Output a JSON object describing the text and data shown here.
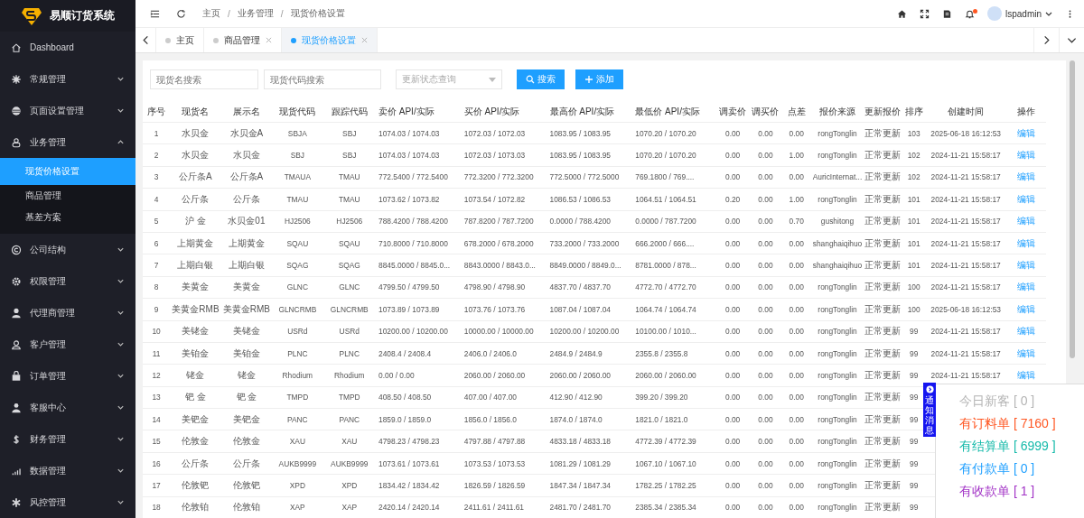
{
  "brand": {
    "title": "易顺订货系统"
  },
  "sidebar": {
    "items": [
      {
        "label": "Dashboard",
        "kind": "link"
      },
      {
        "label": "常规管理",
        "kind": "group",
        "expanded": false
      },
      {
        "label": "页面设置管理",
        "kind": "group",
        "expanded": false
      },
      {
        "label": "业务管理",
        "kind": "group",
        "expanded": true,
        "children": [
          {
            "label": "现货价格设置",
            "selected": true
          },
          {
            "label": "商品管理",
            "selected": false
          },
          {
            "label": "基差方案",
            "selected": false
          }
        ]
      },
      {
        "label": "公司结构",
        "kind": "group",
        "expanded": false
      },
      {
        "label": "权限管理",
        "kind": "group",
        "expanded": false
      },
      {
        "label": "代理商管理",
        "kind": "group",
        "expanded": false
      },
      {
        "label": "客户管理",
        "kind": "group",
        "expanded": false
      },
      {
        "label": "订单管理",
        "kind": "group",
        "expanded": false
      },
      {
        "label": "客服中心",
        "kind": "group",
        "expanded": false
      },
      {
        "label": "财务管理",
        "kind": "group",
        "expanded": false
      },
      {
        "label": "数据管理",
        "kind": "group",
        "expanded": false
      },
      {
        "label": "风控管理",
        "kind": "group",
        "expanded": false
      }
    ]
  },
  "header": {
    "breadcrumb": [
      "主页",
      "业务管理",
      "现货价格设置"
    ],
    "breadcrumb_separator": "/",
    "user": "lspadmin",
    "notification_dot": true
  },
  "tabs": [
    {
      "label": "主页",
      "selected": false,
      "closable": false
    },
    {
      "label": "商品管理",
      "selected": false,
      "closable": true
    },
    {
      "label": "现货价格设置",
      "selected": true,
      "closable": true
    }
  ],
  "filters": {
    "name_placeholder": "现货名搜索",
    "code_placeholder": "现货代码搜索",
    "status_placeholder": "更新状态查询",
    "search_button": "搜索",
    "add_button": "添加"
  },
  "table": {
    "columns": [
      "序号",
      "现货名",
      "展示名",
      "现货代码",
      "跟踪代码",
      "卖价 API/实际",
      "买价 API/实际",
      "最高价 API/实际",
      "最低价 API/实际",
      "调卖价",
      "调买价",
      "点差",
      "报价来源",
      "更新报价",
      "排序",
      "创建时间",
      "操作"
    ],
    "rows": [
      [
        "1",
        "水贝金",
        "水贝金A",
        "SBJA",
        "SBJ",
        "1074.03 / 1074.03",
        "1072.03 / 1072.03",
        "1083.95 / 1083.95",
        "1070.20 / 1070.20",
        "0.00",
        "0.00",
        "0.00",
        "rongTonglin",
        "正常更新",
        "103",
        "2025-06-18 16:12:53",
        "编辑"
      ],
      [
        "2",
        "水贝金",
        "水贝金",
        "SBJ",
        "SBJ",
        "1074.03 / 1074.03",
        "1072.03 / 1073.03",
        "1083.95 / 1083.95",
        "1070.20 / 1070.20",
        "0.00",
        "0.00",
        "1.00",
        "rongTonglin",
        "正常更新",
        "102",
        "2024-11-21 15:58:17",
        "编辑"
      ],
      [
        "3",
        "公斤条A",
        "公斤条A",
        "TMAUA",
        "TMAU",
        "772.5400 / 772.5400",
        "772.3200 / 772.3200",
        "772.5000 / 772.5000",
        "769.1800 / 769....",
        "0.00",
        "0.00",
        "0.00",
        "AuricInternat...",
        "正常更新",
        "102",
        "2024-11-21 15:58:17",
        "编辑"
      ],
      [
        "4",
        "公斤条",
        "公斤条",
        "TMAU",
        "TMAU",
        "1073.62 / 1073.82",
        "1073.54 / 1072.82",
        "1086.53 / 1086.53",
        "1064.51 / 1064.51",
        "0.20",
        "0.00",
        "1.00",
        "rongTonglin",
        "正常更新",
        "101",
        "2024-11-21 15:58:17",
        "编辑"
      ],
      [
        "5",
        "沪 金",
        "水贝金01",
        "HJ2506",
        "HJ2506",
        "788.4200 / 788.4200",
        "787.8200 / 787.7200",
        "0.0000 / 788.4200",
        "0.0000 / 787.7200",
        "0.00",
        "0.00",
        "0.70",
        "gushitong",
        "正常更新",
        "101",
        "2024-11-21 15:58:17",
        "编辑"
      ],
      [
        "6",
        "上期黄金",
        "上期黄金",
        "SQAU",
        "SQAU",
        "710.8000 / 710.8000",
        "678.2000 / 678.2000",
        "733.2000 / 733.2000",
        "666.2000 / 666....",
        "0.00",
        "0.00",
        "0.00",
        "shanghaiqihuo",
        "正常更新",
        "101",
        "2024-11-21 15:58:17",
        "编辑"
      ],
      [
        "7",
        "上期白银",
        "上期白银",
        "SQAG",
        "SQAG",
        "8845.0000 / 8845.0...",
        "8843.0000 / 8843.0...",
        "8849.0000 / 8849.0...",
        "8781.0000 / 878...",
        "0.00",
        "0.00",
        "0.00",
        "shanghaiqihuo",
        "正常更新",
        "101",
        "2024-11-21 15:58:17",
        "编辑"
      ],
      [
        "8",
        "美黄金",
        "美黄金",
        "GLNC",
        "GLNC",
        "4799.50 / 4799.50",
        "4798.90 / 4798.90",
        "4837.70 / 4837.70",
        "4772.70 / 4772.70",
        "0.00",
        "0.00",
        "0.00",
        "rongTonglin",
        "正常更新",
        "100",
        "2024-11-21 15:58:17",
        "编辑"
      ],
      [
        "9",
        "美黄金RMB",
        "美黄金RMB",
        "GLNCRMB",
        "GLNCRMB",
        "1073.89 / 1073.89",
        "1073.76 / 1073.76",
        "1087.04 / 1087.04",
        "1064.74 / 1064.74",
        "0.00",
        "0.00",
        "0.00",
        "rongTonglin",
        "正常更新",
        "100",
        "2025-06-18 16:12:53",
        "编辑"
      ],
      [
        "10",
        "美铑金",
        "美铑金",
        "USRd",
        "USRd",
        "10200.00 / 10200.00",
        "10000.00 / 10000.00",
        "10200.00 / 10200.00",
        "10100.00 / 1010...",
        "0.00",
        "0.00",
        "0.00",
        "rongTonglin",
        "正常更新",
        "99",
        "2024-11-21 15:58:17",
        "编辑"
      ],
      [
        "11",
        "美铂金",
        "美铂金",
        "PLNC",
        "PLNC",
        "2408.4 / 2408.4",
        "2406.0 / 2406.0",
        "2484.9 / 2484.9",
        "2355.8 / 2355.8",
        "0.00",
        "0.00",
        "0.00",
        "rongTonglin",
        "正常更新",
        "99",
        "2024-11-21 15:58:17",
        "编辑"
      ],
      [
        "12",
        "铑金",
        "铑金",
        "Rhodium",
        "Rhodium",
        "0.00 / 0.00",
        "2060.00 / 2060.00",
        "2060.00 / 2060.00",
        "2060.00 / 2060.00",
        "0.00",
        "0.00",
        "0.00",
        "rongTonglin",
        "正常更新",
        "99",
        "2024-11-21 15:58:17",
        "编辑"
      ],
      [
        "13",
        "钯 金",
        "钯 金",
        "TMPD",
        "TMPD",
        "408.50 / 408.50",
        "407.00 / 407.00",
        "412.90 / 412.90",
        "399.20 / 399.20",
        "0.00",
        "0.00",
        "0.00",
        "rongTonglin",
        "正常更新",
        "99"
      ],
      [
        "14",
        "美钯金",
        "美钯金",
        "PANC",
        "PANC",
        "1859.0 / 1859.0",
        "1856.0 / 1856.0",
        "1874.0 / 1874.0",
        "1821.0 / 1821.0",
        "0.00",
        "0.00",
        "0.00",
        "rongTonglin",
        "正常更新",
        "99"
      ],
      [
        "15",
        "伦敦金",
        "伦敦金",
        "XAU",
        "XAU",
        "4798.23 / 4798.23",
        "4797.88 / 4797.88",
        "4833.18 / 4833.18",
        "4772.39 / 4772.39",
        "0.00",
        "0.00",
        "0.00",
        "rongTonglin",
        "正常更新",
        "99"
      ],
      [
        "16",
        "公斤条",
        "公斤条",
        "AUKB9999",
        "AUKB9999",
        "1073.61 / 1073.61",
        "1073.53 / 1073.53",
        "1081.29 / 1081.29",
        "1067.10 / 1067.10",
        "0.00",
        "0.00",
        "0.00",
        "rongTonglin",
        "正常更新",
        "99"
      ],
      [
        "17",
        "伦敦钯",
        "伦敦钯",
        "XPD",
        "XPD",
        "1834.42 / 1834.42",
        "1826.59 / 1826.59",
        "1847.34 / 1847.34",
        "1782.25 / 1782.25",
        "0.00",
        "0.00",
        "0.00",
        "rongTonglin",
        "正常更新",
        "99"
      ],
      [
        "18",
        "伦敦铂",
        "伦敦铂",
        "XAP",
        "XAP",
        "2420.14 / 2420.14",
        "2411.61 / 2411.61",
        "2481.70 / 2481.70",
        "2385.34 / 2385.34",
        "0.00",
        "0.00",
        "0.00",
        "rongTonglin",
        "正常更新",
        "99"
      ]
    ]
  },
  "notice": {
    "tab": "通知消息",
    "items": [
      {
        "text": "今日新客 [ 0 ]",
        "color": "#b4b4b4"
      },
      {
        "text": "有订料单 [ 7160 ]",
        "color": "#ff5722"
      },
      {
        "text": "有结算单 [ 6999 ]",
        "color": "#16baaa"
      },
      {
        "text": "有付款单 [ 0 ]",
        "color": "#1e9fff"
      },
      {
        "text": "有收款单 [ 1 ]",
        "color": "#a233c6"
      }
    ]
  }
}
